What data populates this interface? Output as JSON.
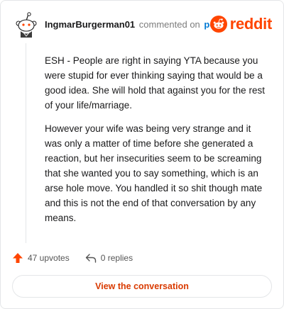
{
  "header": {
    "author": "IngmarBurgerman01",
    "action_text": "commented on",
    "post_link": "post",
    "brand": "reddit"
  },
  "comment": {
    "paragraphs": [
      "ESH - People are right in saying YTA because you were stupid for ever thinking saying that would be a good idea. She will hold that against you for the rest of your life/marriage.",
      "However your wife was being very strange and it was only a matter of time before she generated a reaction, but her insecurities seem to be screaming that she wanted you to say something, which is an arse hole move. You handled it so shit though mate and this is not the end of that conversation by any means."
    ]
  },
  "actions": {
    "upvotes": "47 upvotes",
    "replies": "0 replies"
  },
  "button": {
    "label": "View the conversation"
  },
  "colors": {
    "brand": "#ff4500",
    "link": "#0079d3",
    "button_text": "#d93a00",
    "border": "#e4e6e8"
  },
  "icons": [
    "snoo-avatar-icon",
    "reddit-logo-icon",
    "upvote-arrow-icon",
    "reply-arrow-icon"
  ]
}
